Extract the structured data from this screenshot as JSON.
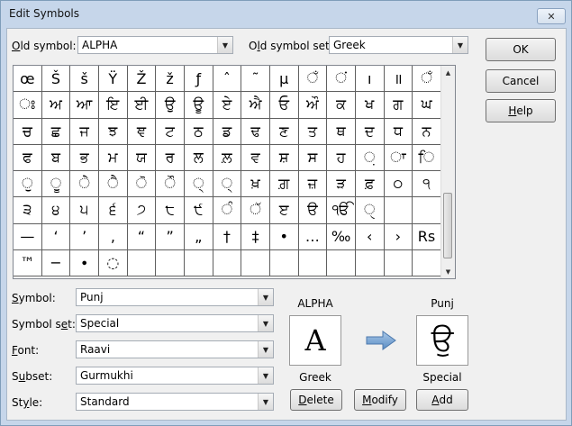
{
  "window": {
    "title": "Edit Symbols",
    "close_glyph": "✕"
  },
  "old_symbol": {
    "label_u": "O",
    "label_rest": "ld symbol:",
    "value": "ALPHA"
  },
  "old_symbol_set": {
    "label_pre": "O",
    "label_u": "l",
    "label_rest": "d symbol set:",
    "value": "Greek"
  },
  "buttons": {
    "ok": "OK",
    "cancel": "Cancel",
    "help_u": "H",
    "help_rest": "elp",
    "delete_u": "D",
    "delete_rest": "elete",
    "modify_u": "M",
    "modify_rest": "odify",
    "add_u": "A",
    "add_rest": "dd"
  },
  "grid": {
    "rows": [
      [
        "œ",
        "Š",
        "š",
        "Ÿ",
        "Ž",
        "ž",
        "ƒ",
        "ˆ",
        "˜",
        "µ",
        "ਁ",
        "ਂ",
        "ı",
        "॥",
        "ਁ",
        "ਂ"
      ],
      [
        "ਃ",
        "ਅ",
        "ਆ",
        "ਇ",
        "ਈ",
        "ਉ",
        "ਊ",
        "ਏ",
        "ਐ",
        "ਓ",
        "ਔ",
        "ਕ",
        "ਖ",
        "ਗ",
        "ਘ",
        "ਙ"
      ],
      [
        "ਚ",
        "ਛ",
        "ਜ",
        "ਝ",
        "ਞ",
        "ਟ",
        "ਠ",
        "ਡ",
        "ਢ",
        "ਣ",
        "ਤ",
        "ਥ",
        "ਦ",
        "ਧ",
        "ਨ",
        "ਪ"
      ],
      [
        "ਫ",
        "ਬ",
        "ਭ",
        "ਮ",
        "ਯ",
        "ਰ",
        "ਲ",
        "ਲ਼",
        "ਵ",
        "ਸ਼",
        "ਸ",
        "ਹ",
        "਼",
        "ਾ",
        "ਿ",
        "ੀ"
      ],
      [
        "ੁ",
        "ੂ",
        "ੇ",
        "ੈ",
        "ੋ",
        "ੌ",
        "੍",
        "੍",
        "ਖ਼",
        "ਗ਼",
        "ਜ਼",
        "ੜ",
        "ਫ਼",
        "੦",
        "੧",
        "੨"
      ],
      [
        "੩",
        "੪",
        "੫",
        "੬",
        "੭",
        "੮",
        "੯",
        "ੰ",
        "ੱ",
        "ੲ",
        "ੳ",
        "ੴ",
        "ੑ",
        "",
        "",
        "–"
      ],
      [
        "—",
        "‘",
        "’",
        "‚",
        "“",
        "”",
        "„",
        "†",
        "‡",
        "•",
        "…",
        "‰",
        "‹",
        "›",
        "Rs",
        "€"
      ],
      [
        "™",
        "−",
        "∙",
        "◌",
        "",
        "",
        "",
        "",
        "",
        "",
        "",
        "",
        "",
        "",
        "",
        ""
      ]
    ]
  },
  "fields": {
    "symbol": {
      "label_u": "S",
      "label_rest": "ymbol:",
      "value": "Punj"
    },
    "symbol_set": {
      "label_pre": "Symbol s",
      "label_u": "e",
      "label_rest": "t:",
      "value": "Special"
    },
    "font": {
      "label_u": "F",
      "label_rest": "ont:",
      "value": "Raavi"
    },
    "subset": {
      "label_pre": "S",
      "label_u": "u",
      "label_rest": "bset:",
      "value": "Gurmukhi"
    },
    "style": {
      "label_pre": "St",
      "label_u": "y",
      "label_rest": "le:",
      "value": "Standard"
    }
  },
  "preview_old": {
    "name": "ALPHA",
    "glyph": "A",
    "set": "Greek"
  },
  "preview_new": {
    "name": "Punj",
    "glyph": "ਉ",
    "set": "Special"
  },
  "arrow_icon": "arrow-right-icon"
}
